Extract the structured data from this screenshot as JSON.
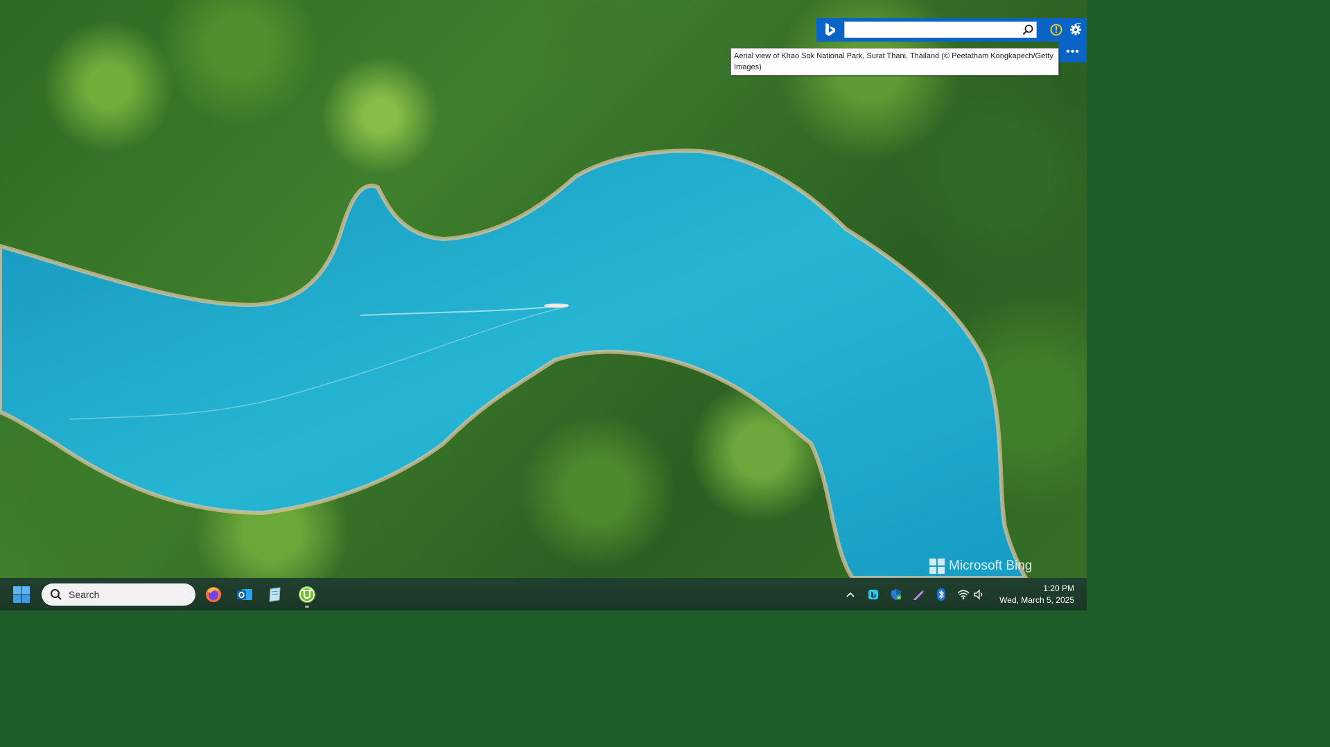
{
  "bing_toolbar": {
    "search_value": "",
    "tooltip": "Aerial view of Khao Sok National Park, Surat Thani, Thailand (© Peetatham Kongkapech/Getty Images)",
    "more_label": "•••",
    "minimize_label": "–"
  },
  "watermark": {
    "text": "Microsoft Bing"
  },
  "taskbar": {
    "search_placeholder": "Search",
    "apps": [
      "firefox-icon",
      "outlook-icon",
      "notepad-icon",
      "utorrent-icon"
    ],
    "tray_icons": [
      "chevron-up-icon",
      "bing-tray-icon",
      "defender-icon",
      "pen-icon",
      "bluetooth-icon",
      "wifi-icon",
      "volume-icon"
    ],
    "clock": {
      "time": "1:20 PM",
      "date": "Wed, March 5, 2025"
    }
  },
  "colors": {
    "bing_blue": "#0a63c7",
    "water": "#1aa6c9",
    "taskbar": "#1c3a2c"
  }
}
